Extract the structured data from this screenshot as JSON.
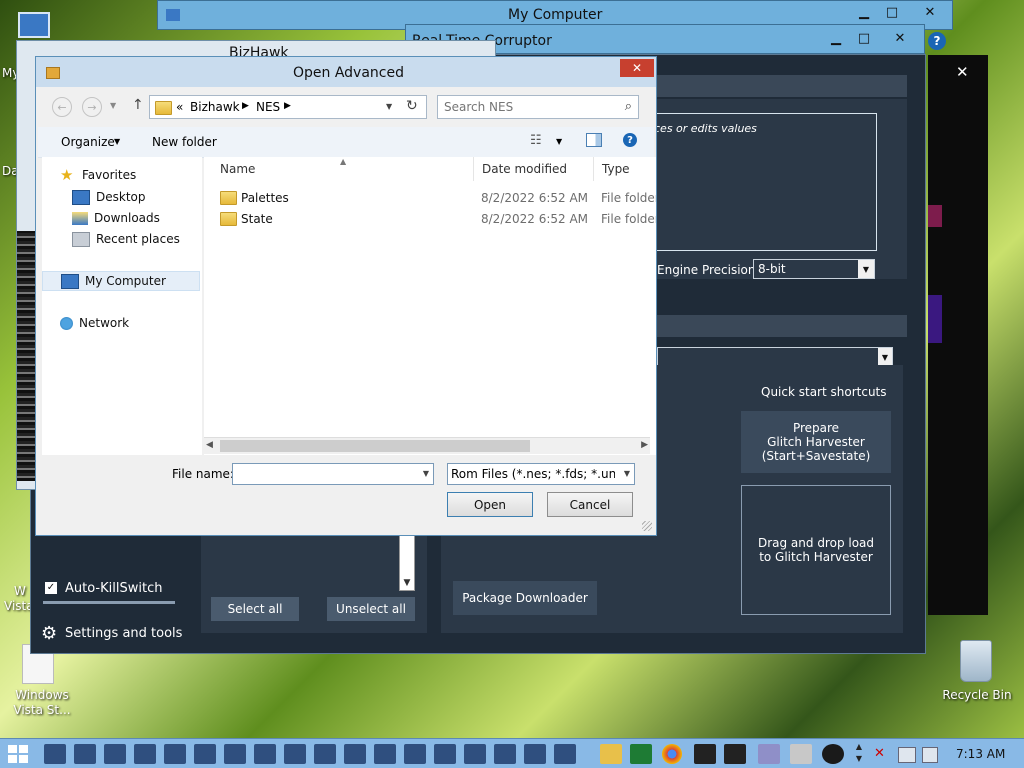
{
  "my_computer_window": {
    "title": "My Computer"
  },
  "rtc_window": {
    "title": "Real-Time Corruptor",
    "engine_desc_fragment": "ces or edits values",
    "engine_precision_label": "Engine Precision:",
    "engine_precision_value": "8-bit",
    "quick_start_title": "Quick start shortcuts",
    "prepare_button": "Prepare\nGlitch Harvester\n(Start+Savestate)",
    "drag_drop_button": "Drag and drop load\nto Glitch Harvester",
    "package_downloader_button": "Package Downloader",
    "select_all_button": "Select all",
    "unselect_all_button": "Unselect all",
    "auto_killswitch_label": "Auto-KillSwitch",
    "settings_label": "Settings and tools"
  },
  "bizhawk_window": {
    "title": "BizHawk"
  },
  "dialog": {
    "title": "Open Advanced",
    "breadcrumb": {
      "prefix": "«",
      "items": [
        "Bizhawk",
        "NES"
      ]
    },
    "search_placeholder": "Search NES",
    "organize_label": "Organize",
    "new_folder_label": "New folder",
    "nav": {
      "favorites": "Favorites",
      "desktop": "Desktop",
      "downloads": "Downloads",
      "recent_places": "Recent places",
      "my_computer": "My Computer",
      "network": "Network"
    },
    "columns": {
      "name": "Name",
      "date_modified": "Date modified",
      "type": "Type"
    },
    "files": [
      {
        "name": "Palettes",
        "date": "8/2/2022 6:52 AM",
        "type": "File folder"
      },
      {
        "name": "State",
        "date": "8/2/2022 6:52 AM",
        "type": "File folder"
      }
    ],
    "filename_label": "File name:",
    "filename_value": "",
    "filter_value": "Rom Files (*.nes; *.fds; *.unf; *.s",
    "open_button": "Open",
    "cancel_button": "Cancel"
  },
  "desktop": {
    "icon_windows_vista_1": "Windows\nVista St...",
    "icon_recycle_bin": "Recycle Bin",
    "partial_labels": [
      "My",
      "Da",
      "W",
      "Vista"
    ]
  },
  "taskbar": {
    "clock": "7:13 AM"
  },
  "colors": {
    "rtc_bg": "#1f2b38",
    "rtc_panel": "#2b3847",
    "dialog_close": "#c7402f",
    "taskbar": "#89b9e6"
  }
}
